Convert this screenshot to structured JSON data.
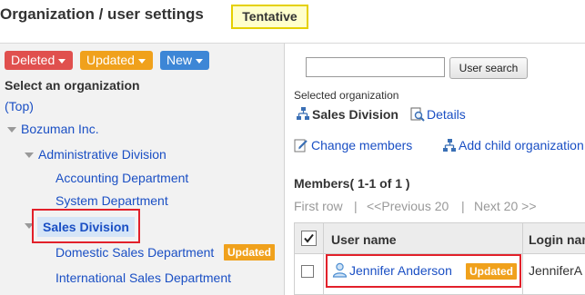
{
  "header": {
    "title": "Organization / user settings",
    "badge": "Tentative"
  },
  "filters": {
    "deleted": "Deleted",
    "updated": "Updated",
    "new": "New"
  },
  "left": {
    "heading": "Select an organization",
    "top_link": "(Top)",
    "root": "Bozuman Inc.",
    "admin_division": "Administrative Division",
    "accounting": "Accounting Department",
    "system": "System Department",
    "sales": "Sales Division",
    "domestic": "Domestic Sales Department",
    "international": "International Sales Department",
    "updated_tag": "Updated"
  },
  "right": {
    "search_button": "User search",
    "selected_label": "Selected organization",
    "selected_org": "Sales Division",
    "details_link": "Details",
    "change_members": "Change members",
    "add_child": "Add child organization",
    "members_label": "Members( 1-1 of 1 )",
    "pager": {
      "first": "First row",
      "sep1": "|",
      "prev": "<<Previous 20",
      "sep2": "|",
      "next": "Next 20 >>"
    },
    "table": {
      "headers": {
        "username": "User name",
        "login": "Login name"
      },
      "rows": [
        {
          "name": "Jennifer Anderson",
          "tag": "Updated",
          "login": "JenniferA"
        }
      ]
    }
  }
}
